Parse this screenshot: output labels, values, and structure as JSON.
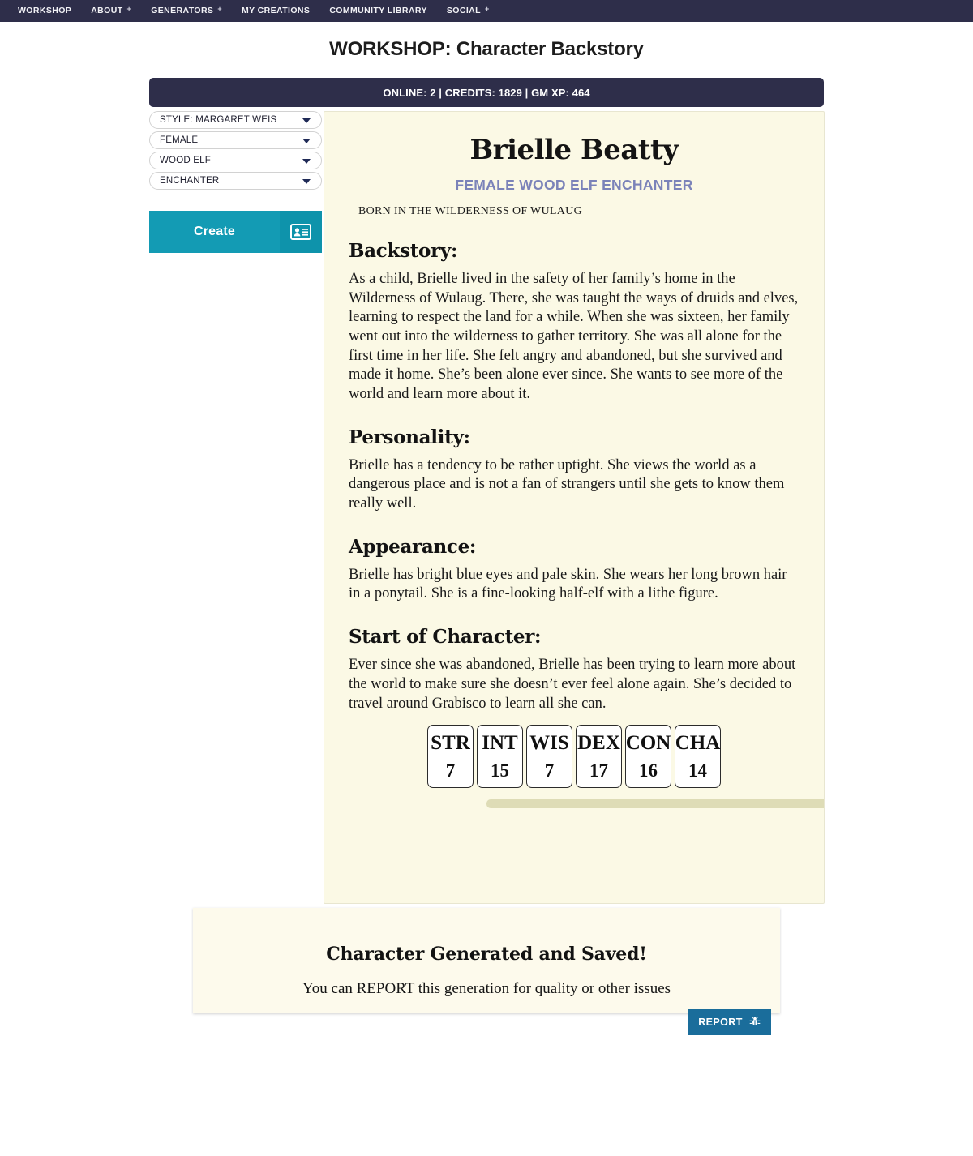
{
  "nav": {
    "items": [
      {
        "label": "WORKSHOP",
        "has_plus": false
      },
      {
        "label": "ABOUT",
        "has_plus": true,
        "plus": "+"
      },
      {
        "label": "GENERATORS",
        "has_plus": true,
        "plus": "+"
      },
      {
        "label": "MY CREATIONS",
        "has_plus": false
      },
      {
        "label": "COMMUNITY LIBRARY",
        "has_plus": false
      },
      {
        "label": "SOCIAL",
        "has_plus": true,
        "plus": "+"
      }
    ]
  },
  "header": {
    "title": "WORKSHOP: Character Backstory"
  },
  "status": {
    "text": "ONLINE: 2 | CREDITS: 1829 | GM XP: 464"
  },
  "sidebar": {
    "selects": [
      {
        "value": "STYLE: MARGARET WEIS",
        "name": "style-select"
      },
      {
        "value": "FEMALE",
        "name": "gender-select"
      },
      {
        "value": "WOOD ELF",
        "name": "race-select"
      },
      {
        "value": "ENCHANTER",
        "name": "class-select"
      }
    ],
    "create_label": "Create",
    "create_icon": "id-card-icon"
  },
  "character": {
    "name": "Brielle Beatty",
    "subtitle": "FEMALE WOOD ELF ENCHANTER",
    "born": "BORN IN THE WILDERNESS OF WULAUG",
    "sections": [
      {
        "heading": "Backstory:",
        "body": "As a child, Brielle lived in the safety of her family’s home in the Wilderness of Wulaug. There, she was taught the ways of druids and elves, learning to respect the land for a while. When she was sixteen, her family went out into the wilderness to gather territory. She was all alone for the first time in her life. She felt angry and abandoned, but she survived and made it home. She’s been alone ever since. She wants to see more of the world and learn more about it."
      },
      {
        "heading": "Personality:",
        "body": "Brielle has a tendency to be rather uptight. She views the world as a dangerous place and is not a fan of strangers until she gets to know them really well."
      },
      {
        "heading": "Appearance:",
        "body": "Brielle has bright blue eyes and pale skin. She wears her long brown hair in a ponytail. She is a fine-looking half-elf with a lithe figure."
      },
      {
        "heading": "Start of Character:",
        "body": "Ever since she was abandoned, Brielle has been trying to learn more about the world to make sure she doesn’t ever feel alone again. She’s decided to travel around Grabisco to learn all she can."
      }
    ],
    "stats": [
      {
        "label": "STR",
        "value": "7"
      },
      {
        "label": "INT",
        "value": "15"
      },
      {
        "label": "WIS",
        "value": "7"
      },
      {
        "label": "DEX",
        "value": "17"
      },
      {
        "label": "CON",
        "value": "16"
      },
      {
        "label": "CHA",
        "value": "14"
      }
    ]
  },
  "notification": {
    "title": "Character Generated and Saved!",
    "subtitle": "You can REPORT this generation for quality or other issues",
    "report_label": "REPORT",
    "report_icon": "bug-icon"
  },
  "colors": {
    "nav_bg": "#2e2e4a",
    "accent_teal": "#139bb4",
    "report_blue": "#1a6d9b",
    "card_cream": "#fbf9e5",
    "subtitle_periwinkle": "#7b83b9"
  }
}
